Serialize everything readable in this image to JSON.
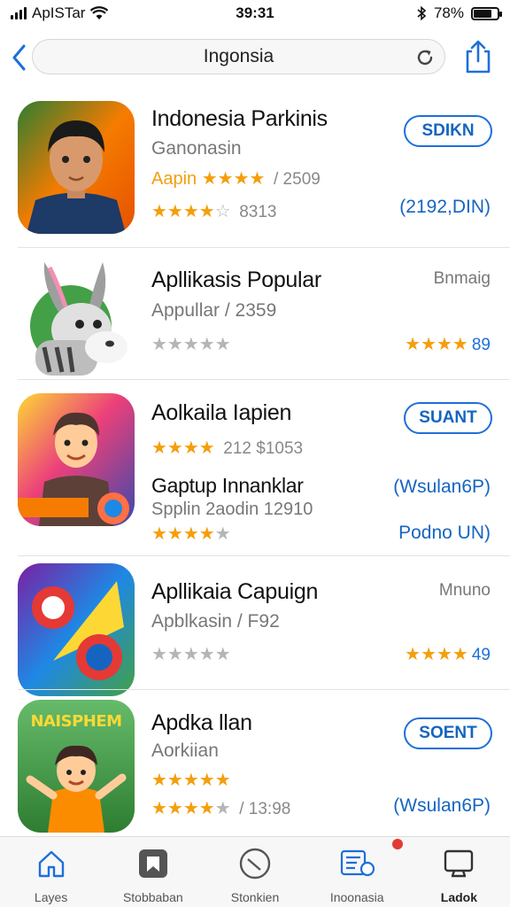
{
  "status_bar": {
    "carrier": "ApISTar",
    "time": "39:31",
    "battery": "78%",
    "battery_level": 0.78
  },
  "nav": {
    "search_value": "Ingonsia"
  },
  "apps": [
    {
      "title": "Indonesia Parkinis",
      "subtitle": "Ganonasin",
      "rating1_prefix": "Aapin",
      "rating1_stars": 4,
      "rating1_meta": "/ 2509",
      "rating2_stars": 4,
      "rating2_meta": "8313",
      "action_label": "SDIKN",
      "price": "(2192,DIN)"
    },
    {
      "title": "Apllikasis Popular",
      "subtitle": "Appullar / 2359",
      "rating_stars": 4,
      "right_label": "Bnmaig",
      "right_rating": "89"
    },
    {
      "title": "Aolkaila Iapien",
      "rating_stars": 4,
      "rating_meta": "212 $1053",
      "second_title": "Gaptup Innanklar",
      "second_sub": "Spplin 2aodin 12910",
      "second_stars": 4,
      "action_label": "SUANT",
      "link1": "(Wsulan6P)",
      "link2": "Podno UN)"
    },
    {
      "title": "Apllikaia Capuign",
      "subtitle": "Apblkasin / F92",
      "rating_stars": 4,
      "right_label": "Mnuno",
      "right_rating": "49"
    },
    {
      "title": "Apdka llan",
      "subtitle": "Aorkiian",
      "rating1_stars": 5,
      "rating2_stars": 4,
      "rating2_meta": "/ 13:98",
      "action_label": "SOENT",
      "link1": "(Wsulan6P)",
      "icon_text": "NAISPHEM"
    }
  ],
  "tabs": [
    {
      "label": "Layes",
      "icon": "home-icon"
    },
    {
      "label": "Stobbaban",
      "icon": "bookmark-icon"
    },
    {
      "label": "Stonkien",
      "icon": "search-icon"
    },
    {
      "label": "Inoonasia",
      "icon": "news-icon"
    },
    {
      "label": "Ladok",
      "icon": "desktop-icon",
      "active": true
    }
  ],
  "colors": {
    "accent": "#1e6fd9",
    "star": "#f59e0b",
    "star_off": "#b5b5b5",
    "badge": "#e53935"
  }
}
